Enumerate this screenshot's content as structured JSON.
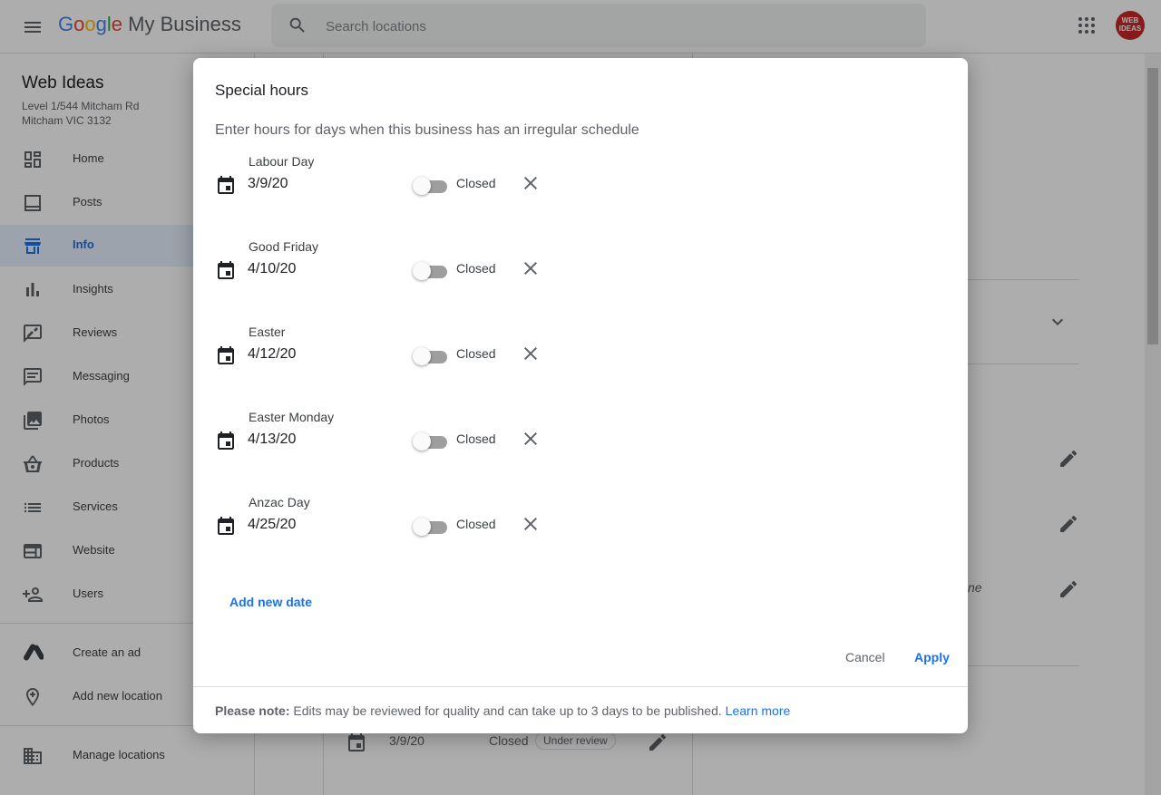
{
  "header": {
    "app_name_google": [
      "G",
      "o",
      "o",
      "g",
      "l",
      "e"
    ],
    "app_name_rest": "My Business",
    "search_placeholder": "Search locations",
    "avatar_text": "WEB IDEAS"
  },
  "sidebar": {
    "business_name": "Web Ideas",
    "address_line1": "Level 1/544 Mitcham Rd",
    "address_line2": "Mitcham VIC 3132",
    "items": [
      {
        "label": "Home",
        "icon": "dashboard-icon"
      },
      {
        "label": "Posts",
        "icon": "posts-icon"
      },
      {
        "label": "Info",
        "icon": "store-icon",
        "active": true
      },
      {
        "label": "Insights",
        "icon": "bar-chart-icon"
      },
      {
        "label": "Reviews",
        "icon": "rate-review-icon"
      },
      {
        "label": "Messaging",
        "icon": "message-icon"
      },
      {
        "label": "Photos",
        "icon": "photo-library-icon"
      },
      {
        "label": "Products",
        "icon": "basket-icon"
      },
      {
        "label": "Services",
        "icon": "list-icon"
      },
      {
        "label": "Website",
        "icon": "web-icon"
      },
      {
        "label": "Users",
        "icon": "person-add-icon"
      },
      {
        "label": "Create an ad",
        "icon": "google-ads-icon"
      },
      {
        "label": "Add new location",
        "icon": "add-location-icon"
      },
      {
        "label": "Manage locations",
        "icon": "business-icon"
      }
    ]
  },
  "background": {
    "row_date": "3/9/20",
    "row_status": "Closed",
    "row_badge": "Under review",
    "partial_text": "ne"
  },
  "dialog": {
    "title": "Special hours",
    "subtitle": "Enter hours for days when this business has an irregular schedule",
    "entries": [
      {
        "name": "Labour Day",
        "date": "3/9/20",
        "status": "Closed",
        "open": false
      },
      {
        "name": "Good Friday",
        "date": "4/10/20",
        "status": "Closed",
        "open": false
      },
      {
        "name": "Easter",
        "date": "4/12/20",
        "status": "Closed",
        "open": false
      },
      {
        "name": "Easter Monday",
        "date": "4/13/20",
        "status": "Closed",
        "open": false
      },
      {
        "name": "Anzac Day",
        "date": "4/25/20",
        "status": "Closed",
        "open": false
      }
    ],
    "add_new_date": "Add new date",
    "cancel": "Cancel",
    "apply": "Apply",
    "note_label": "Please note:",
    "note_text": " Edits may be reviewed for quality and can take up to 3 days to be published. ",
    "learn_more": "Learn more"
  },
  "colors": {
    "accent": "#1a73e8",
    "active_nav_bg": "#e8f0fe",
    "overlay": "rgba(0,0,0,0.32)"
  }
}
